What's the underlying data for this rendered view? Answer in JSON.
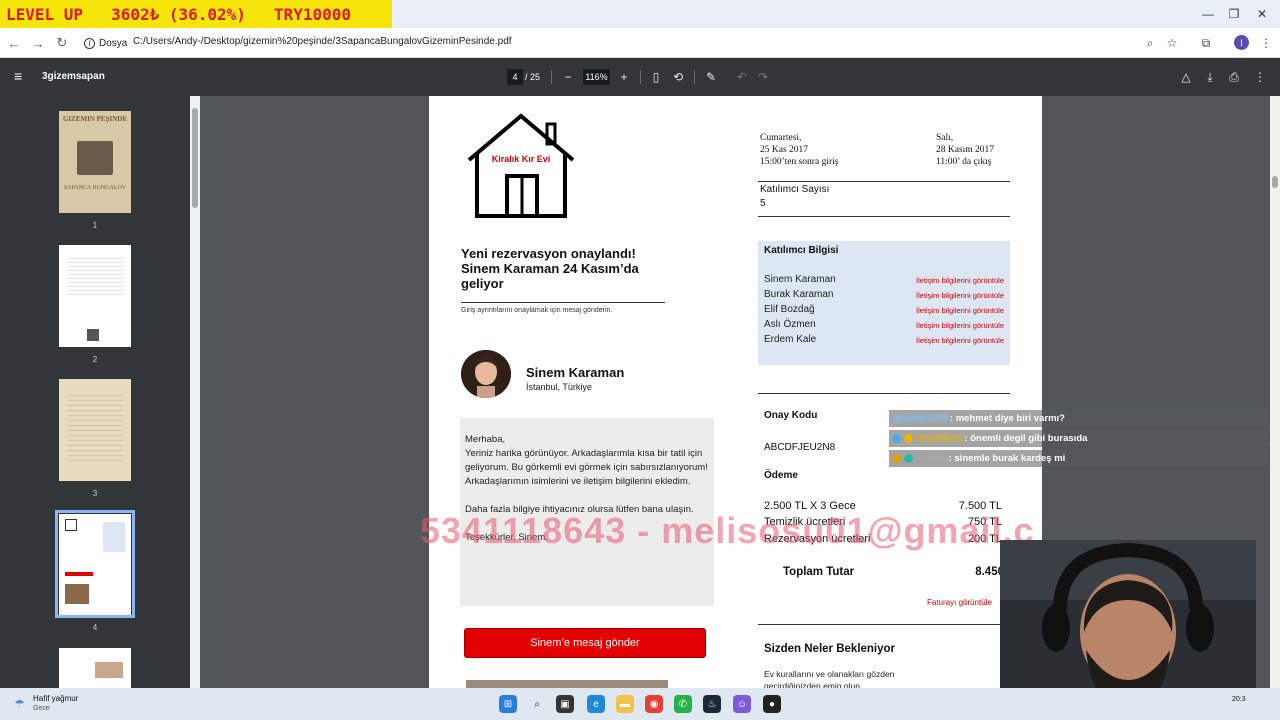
{
  "stream_banner": {
    "level_text": "LEVEL UP",
    "amount_text": "3602₺ (36.02%)",
    "goal_text": "TRY10000"
  },
  "browser": {
    "site_chip": "Dosya",
    "url": "C:/Users/Andy-/Desktop/gizemin%20peşinde/3SapancaBungalovGizeminPesinde.pdf",
    "profile_initial": "I"
  },
  "pdf_toolbar": {
    "doc_title": "3gizemsapan",
    "current_page": "4",
    "total_pages": "/ 25",
    "zoom": "116%"
  },
  "sidebar": {
    "thumbnails": [
      {
        "label": "1"
      },
      {
        "label": "2"
      },
      {
        "label": "3"
      },
      {
        "label": "4"
      }
    ],
    "thumb1_lines": [
      "GIZEMIN PEŞINDE",
      "SAPANCA BUNGALOV"
    ]
  },
  "page": {
    "house_label": "Kiralık Kır Evi",
    "confirm_title": "Yeni rezervasyon onaylandı! Sinem Karaman 24 Kasım’da geliyor",
    "confirm_sub": "Giriş ayrıntılarını onaylamak için mesaj gönderin.",
    "guest_name": "Sinem Karaman",
    "guest_city": "İstanbul, Türkiye",
    "message": [
      "Merhaba,\nYeriniz harika görünüyor. Arkadaşlarımla kısa bir tatil için geliyorum. Bu görkemli evi görmek için sabırsızlanıyorum! Arkadaşlarımın isimlerini  ve iletişim bilgilerini ekledim.",
      "Daha fazla bilgiye ihtiyacınız olursa lütfen bana ulaşın.",
      "Teşekkürler, Sinem."
    ],
    "send_button": "Sinem’e mesaj gönder",
    "checkin": {
      "day": "Cumartesi,",
      "date": "25 Kas 2017",
      "time": "15:00’ten sonra giriş"
    },
    "checkout": {
      "day": "Salı,",
      "date": "28 Kasım 2017",
      "time": "11:00’ da çıkış"
    },
    "participant_label": "Katılımcı Sayısı",
    "participant_count": "5",
    "guest_box_title": "Katılımcı Bilgisi",
    "guests": [
      {
        "name": "Sinem Karaman",
        "link": "İletişim bilgilerini görüntüle"
      },
      {
        "name": "Burak Karaman",
        "link": "İletişim bilgilerini görüntüle"
      },
      {
        "name": "Elif Bozdağ",
        "link": "İletişim bilgilerini görüntüle"
      },
      {
        "name": "Aslı Özmen",
        "link": "İletişim bilgilerini görüntüle"
      },
      {
        "name": "Erdem Kale",
        "link": "İletişim bilgilerini görüntüle"
      }
    ],
    "code_label": "Onay Kodu",
    "code_value": "ABCDFJEU2N8",
    "payment_label": "Ödeme",
    "payments": [
      {
        "label": "2.500 TL X 3 Gece",
        "value": "7.500 TL"
      },
      {
        "label": "Temizlik ücretleri",
        "value": "750 TL"
      },
      {
        "label": "Rezervasyon ücretleri",
        "value": "200 TL"
      }
    ],
    "total_label": "Toplam Tutar",
    "total_value": "8.450",
    "invoice_link": "Faturayı görüntüle",
    "expect_title": "Sizden Neler Bekleniyor",
    "expect_text": "Ev kurallarını ve olanakları gözden geçirdiğinizden emin olun."
  },
  "watermark": "5341118643 - melisosu01@gmail.c",
  "chat": [
    {
      "user": "ghostturn05",
      "text": ": mehmet diye biri varmı?",
      "badge": "#7bd0ff"
    },
    {
      "user": "DavikReis",
      "text": ": önemli degil gibi burasıda",
      "badge": "#f0b400"
    },
    {
      "user": "m###s",
      "text": ": sinemle burak kardeş mi",
      "badge": "#e0a000"
    }
  ],
  "taskbar": {
    "weather_title": "Hafif yağmur",
    "weather_sub": "Gece",
    "time": "20:3"
  },
  "colors": {
    "accent_red": "#e30000",
    "banner_yellow": "#f5e50a",
    "guest_box_bg": "#dde6f3",
    "pdf_toolbar": "#323639"
  }
}
